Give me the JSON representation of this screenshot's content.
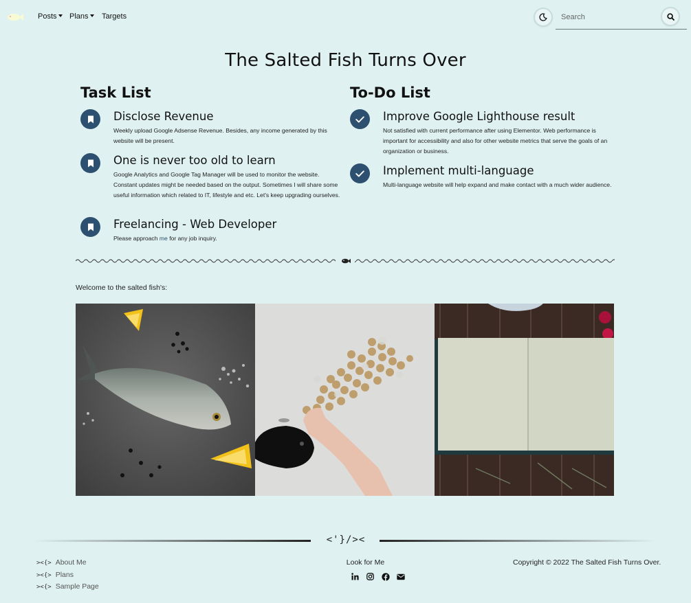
{
  "nav": {
    "logo_icon": "fish-logo-icon",
    "items": [
      {
        "label": "Posts",
        "has_dropdown": true
      },
      {
        "label": "Plans",
        "has_dropdown": true
      },
      {
        "label": "Targets",
        "has_dropdown": false
      }
    ],
    "theme_toggle_icon": "moon-icon",
    "search": {
      "placeholder": "Search",
      "value": "",
      "button_icon": "search-icon"
    }
  },
  "page_title": "The Salted Fish Turns Over",
  "task_list": {
    "heading": "Task List",
    "icon": "bookmark-icon",
    "items": [
      {
        "title": "Disclose Revenue",
        "desc": "Weekly upload Google Adsense Revenue. Besides, any income generated by this website will be present."
      },
      {
        "title": "One is never too old to learn",
        "desc": "Google Analytics and Google Tag Manager will be used to monitor the website. Constant updates might be needed based on the output. Sometimes I will share some useful information which related to IT, lifestyle and etc. Let's keep upgrading ourselves."
      },
      {
        "title": "Freelancing - Web Developer",
        "desc_before": "Please approach ",
        "desc_link": "me",
        "desc_after": " for any job inquiry."
      }
    ]
  },
  "todo_list": {
    "heading": "To-Do List",
    "icon": "check-icon",
    "items": [
      {
        "title": "Improve Google Lighthouse result",
        "desc": "Not satisfied with current performance after using Elementor. Web performance is important for accessibility and also for other website metrics that serve the goals of an organization or business."
      },
      {
        "title": "Implement multi-language",
        "desc": "Multi-language website will help expand and make contact with a much wider audience."
      }
    ]
  },
  "divider_icon": "fish-icon",
  "welcome_text": "Welcome to the salted fish's:",
  "gallery": [
    {
      "name": "fish-photo"
    },
    {
      "name": "piggy-bank-coins-photo"
    },
    {
      "name": "open-notebook-photo"
    }
  ],
  "footer": {
    "mark": "<'}/><",
    "links": [
      {
        "bullet": "><{>",
        "label": "About Me"
      },
      {
        "bullet": "><{>",
        "label": "Plans"
      },
      {
        "bullet": "><{>",
        "label": "Sample Page"
      }
    ],
    "look_title": "Look for Me",
    "socials": [
      "linkedin-icon",
      "instagram-icon",
      "facebook-icon",
      "email-icon"
    ],
    "copyright": "Copyright © 2022 The Salted Fish Turns Over."
  },
  "colors": {
    "background": "#dff1f0",
    "accent": "#2e5070"
  }
}
